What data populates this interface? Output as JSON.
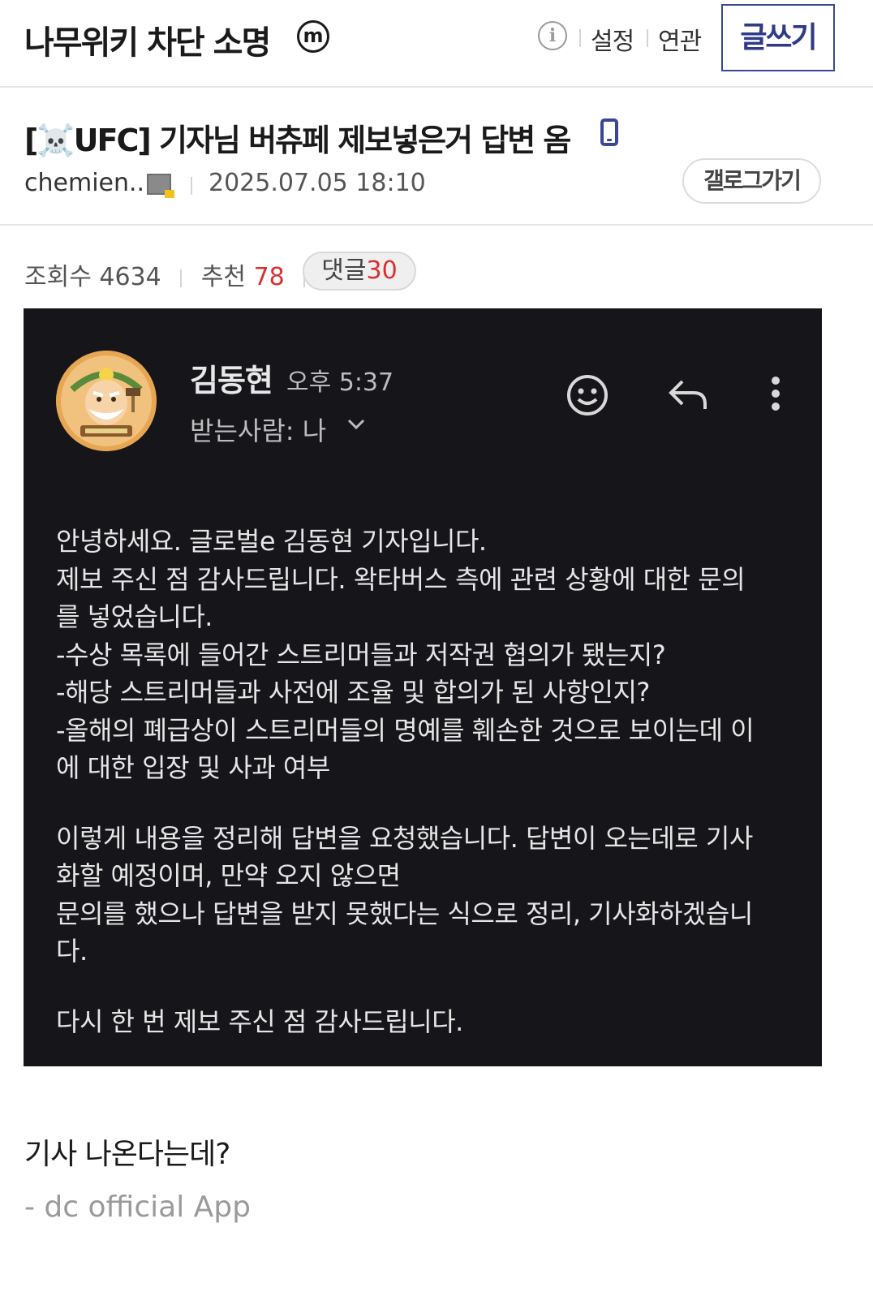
{
  "header": {
    "gallery_title": "나무위키 차단 소명",
    "minor_badge": "m",
    "links": [
      "설정",
      "연관"
    ],
    "write_label": "글쓰기",
    "accent_color": "#3b4890"
  },
  "post": {
    "title": "[☠️UFC] 기자님 버츄페 제보넣은거 답변 옴",
    "author": "chemien..",
    "date": "2025.07.05 18:10",
    "gallery_button": "갤로그가기",
    "stats": {
      "views_label": "조회수",
      "views": "4634",
      "recommend_label": "추천",
      "recommend": "78",
      "comments_label": "댓글",
      "comments": "30"
    }
  },
  "email": {
    "sender": "김동현",
    "time": "오후 5:37",
    "recipient": "받는사람: 나",
    "lines_1": [
      "안녕하세요. 글로벌e 김동현 기자입니다.",
      "제보 주신 점 감사드립니다. 왁타버스 측에 관련 상황에 대한 문의",
      "를 넣었습니다.",
      "-수상 목록에 들어간 스트리머들과 저작권 협의가 됐는지?",
      "-해당 스트리머들과 사전에 조율 및 합의가 된 사항인지?",
      "-올해의 폐급상이 스트리머들의 명예를 훼손한 것으로 보이는데 이",
      "에 대한 입장 및 사과 여부"
    ],
    "lines_2": [
      "이렇게 내용을 정리해 답변을 요청했습니다. 답변이 오는데로 기사",
      "화할 예정이며, 만약 오지 않으면",
      "문의를 했으나 답변을 받지 못했다는 식으로 정리, 기사화하겠습니",
      "다."
    ],
    "closing": "다시 한 번 제보 주신 점 감사드립니다."
  },
  "body_text": "기사 나온다는데?",
  "signature": "- dc official App"
}
